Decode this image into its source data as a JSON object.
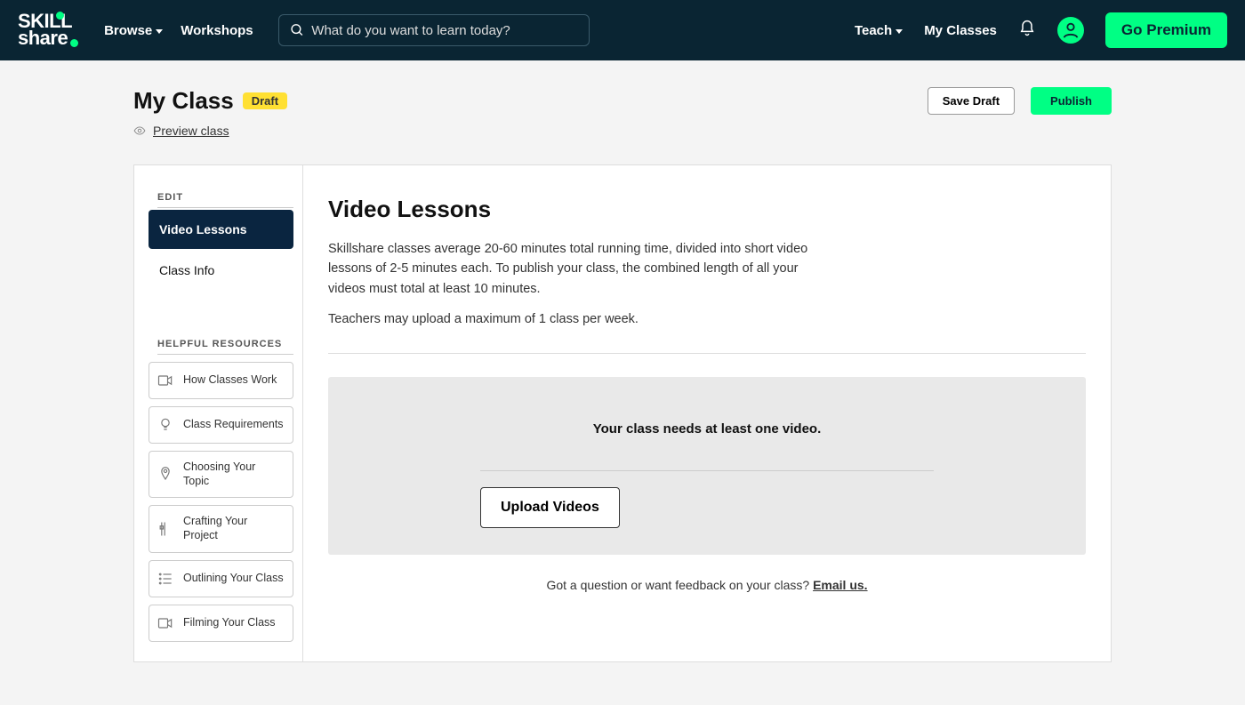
{
  "header": {
    "logo_line1": "SKILL",
    "logo_line2": "share",
    "browse": "Browse",
    "workshops": "Workshops",
    "search_placeholder": "What do you want to learn today?",
    "teach": "Teach",
    "my_classes": "My Classes",
    "go_premium": "Go Premium"
  },
  "page": {
    "title": "My Class",
    "draft_badge": "Draft",
    "save_draft": "Save Draft",
    "publish": "Publish",
    "preview": "Preview class"
  },
  "sidebar": {
    "edit_label": "EDIT",
    "items": [
      {
        "label": "Video Lessons",
        "active": true
      },
      {
        "label": "Class Info",
        "active": false
      }
    ],
    "resources_label": "HELPFUL RESOURCES",
    "resources": [
      {
        "label": "How Classes Work"
      },
      {
        "label": "Class Requirements"
      },
      {
        "label": "Choosing Your Topic"
      },
      {
        "label": "Crafting Your Project"
      },
      {
        "label": "Outlining Your Class"
      },
      {
        "label": "Filming Your Class"
      }
    ]
  },
  "main": {
    "heading": "Video Lessons",
    "para1": "Skillshare classes average 20-60 minutes total running time, divided into short video lessons of 2-5 minutes each. To publish your class, the combined length of all your videos must total at least 10 minutes.",
    "para2": "Teachers may upload a maximum of 1 class per week.",
    "callout_message": "Your class needs at least one video.",
    "upload_button": "Upload Videos",
    "question_prefix": "Got a question or want feedback on your class? ",
    "email_us": "Email us."
  }
}
